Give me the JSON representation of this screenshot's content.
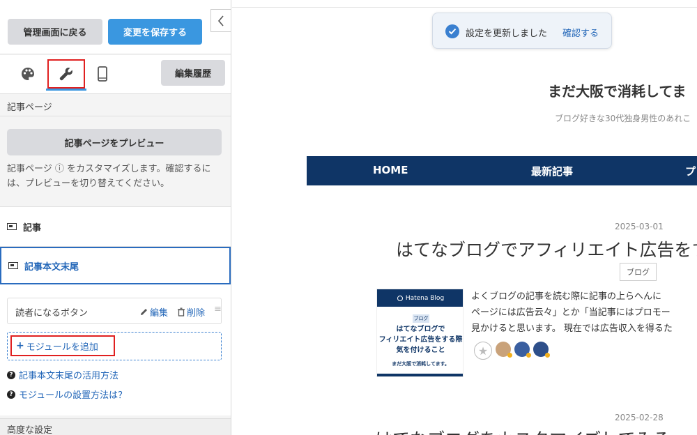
{
  "panel": {
    "back_label": "管理画面に戻る",
    "save_label": "変更を保存する",
    "history_label": "編集履歴",
    "section_title": "記事ページ",
    "preview_button": "記事ページをプレビュー",
    "description": "記事ページ ⓘ をカスタマイズします。確認するには、プレビューを切り替えてください。",
    "items": [
      {
        "label": "記事"
      },
      {
        "label": "記事本文末尾"
      }
    ],
    "module": {
      "name": "読者になるボタン",
      "edit": "編集",
      "delete": "削除"
    },
    "add_module": "モジュールを追加",
    "help_links": [
      "記事本文末尾の活用方法",
      "モジュールの設置方法は？"
    ],
    "advanced_title": "高度な設定"
  },
  "toast": {
    "message": "設定を更新しました",
    "link": "確認する"
  },
  "blog": {
    "title": "まだ大阪で消耗してま",
    "description": "ブログ好きな30代独身男性のあれこ",
    "nav": [
      "HOME",
      "最新記事",
      "プ"
    ]
  },
  "posts": [
    {
      "date": "2025-03-01",
      "title": "はてなブログでアフィリエイト広告をす",
      "category": "ブログ",
      "excerpt": "よくブログの記事を読む際に記事の上らへんに\nページには広告云々」とか「当記事にはプロモー\n見かけると思います。 現在では広告収入を得るた",
      "thumb": {
        "brand": "Hatena Blog",
        "category": "ブログ",
        "title": "はてなブログで\nフィリエイト広告をする際\n気を付けること",
        "subtitle": "まだ大阪で消耗してます。"
      }
    },
    {
      "date": "2025-02-28",
      "title": "はてなブログをカスタマイズしてみる"
    }
  ],
  "colors": {
    "accent": "#3a97e0",
    "nav": "#0f3566",
    "highlight": "#e02020",
    "link": "#2266b8"
  }
}
